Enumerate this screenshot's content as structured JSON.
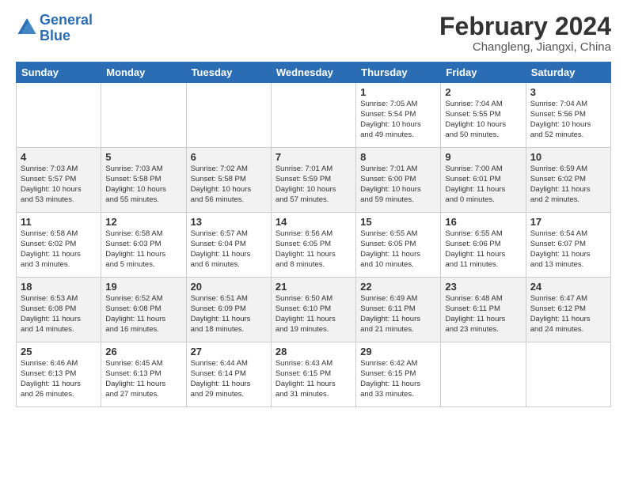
{
  "logo": {
    "line1": "General",
    "line2": "Blue"
  },
  "title": "February 2024",
  "subtitle": "Changleng, Jiangxi, China",
  "days_header": [
    "Sunday",
    "Monday",
    "Tuesday",
    "Wednesday",
    "Thursday",
    "Friday",
    "Saturday"
  ],
  "weeks": [
    [
      {
        "day": "",
        "info": ""
      },
      {
        "day": "",
        "info": ""
      },
      {
        "day": "",
        "info": ""
      },
      {
        "day": "",
        "info": ""
      },
      {
        "day": "1",
        "info": "Sunrise: 7:05 AM\nSunset: 5:54 PM\nDaylight: 10 hours\nand 49 minutes."
      },
      {
        "day": "2",
        "info": "Sunrise: 7:04 AM\nSunset: 5:55 PM\nDaylight: 10 hours\nand 50 minutes."
      },
      {
        "day": "3",
        "info": "Sunrise: 7:04 AM\nSunset: 5:56 PM\nDaylight: 10 hours\nand 52 minutes."
      }
    ],
    [
      {
        "day": "4",
        "info": "Sunrise: 7:03 AM\nSunset: 5:57 PM\nDaylight: 10 hours\nand 53 minutes."
      },
      {
        "day": "5",
        "info": "Sunrise: 7:03 AM\nSunset: 5:58 PM\nDaylight: 10 hours\nand 55 minutes."
      },
      {
        "day": "6",
        "info": "Sunrise: 7:02 AM\nSunset: 5:58 PM\nDaylight: 10 hours\nand 56 minutes."
      },
      {
        "day": "7",
        "info": "Sunrise: 7:01 AM\nSunset: 5:59 PM\nDaylight: 10 hours\nand 57 minutes."
      },
      {
        "day": "8",
        "info": "Sunrise: 7:01 AM\nSunset: 6:00 PM\nDaylight: 10 hours\nand 59 minutes."
      },
      {
        "day": "9",
        "info": "Sunrise: 7:00 AM\nSunset: 6:01 PM\nDaylight: 11 hours\nand 0 minutes."
      },
      {
        "day": "10",
        "info": "Sunrise: 6:59 AM\nSunset: 6:02 PM\nDaylight: 11 hours\nand 2 minutes."
      }
    ],
    [
      {
        "day": "11",
        "info": "Sunrise: 6:58 AM\nSunset: 6:02 PM\nDaylight: 11 hours\nand 3 minutes."
      },
      {
        "day": "12",
        "info": "Sunrise: 6:58 AM\nSunset: 6:03 PM\nDaylight: 11 hours\nand 5 minutes."
      },
      {
        "day": "13",
        "info": "Sunrise: 6:57 AM\nSunset: 6:04 PM\nDaylight: 11 hours\nand 6 minutes."
      },
      {
        "day": "14",
        "info": "Sunrise: 6:56 AM\nSunset: 6:05 PM\nDaylight: 11 hours\nand 8 minutes."
      },
      {
        "day": "15",
        "info": "Sunrise: 6:55 AM\nSunset: 6:05 PM\nDaylight: 11 hours\nand 10 minutes."
      },
      {
        "day": "16",
        "info": "Sunrise: 6:55 AM\nSunset: 6:06 PM\nDaylight: 11 hours\nand 11 minutes."
      },
      {
        "day": "17",
        "info": "Sunrise: 6:54 AM\nSunset: 6:07 PM\nDaylight: 11 hours\nand 13 minutes."
      }
    ],
    [
      {
        "day": "18",
        "info": "Sunrise: 6:53 AM\nSunset: 6:08 PM\nDaylight: 11 hours\nand 14 minutes."
      },
      {
        "day": "19",
        "info": "Sunrise: 6:52 AM\nSunset: 6:08 PM\nDaylight: 11 hours\nand 16 minutes."
      },
      {
        "day": "20",
        "info": "Sunrise: 6:51 AM\nSunset: 6:09 PM\nDaylight: 11 hours\nand 18 minutes."
      },
      {
        "day": "21",
        "info": "Sunrise: 6:50 AM\nSunset: 6:10 PM\nDaylight: 11 hours\nand 19 minutes."
      },
      {
        "day": "22",
        "info": "Sunrise: 6:49 AM\nSunset: 6:11 PM\nDaylight: 11 hours\nand 21 minutes."
      },
      {
        "day": "23",
        "info": "Sunrise: 6:48 AM\nSunset: 6:11 PM\nDaylight: 11 hours\nand 23 minutes."
      },
      {
        "day": "24",
        "info": "Sunrise: 6:47 AM\nSunset: 6:12 PM\nDaylight: 11 hours\nand 24 minutes."
      }
    ],
    [
      {
        "day": "25",
        "info": "Sunrise: 6:46 AM\nSunset: 6:13 PM\nDaylight: 11 hours\nand 26 minutes."
      },
      {
        "day": "26",
        "info": "Sunrise: 6:45 AM\nSunset: 6:13 PM\nDaylight: 11 hours\nand 27 minutes."
      },
      {
        "day": "27",
        "info": "Sunrise: 6:44 AM\nSunset: 6:14 PM\nDaylight: 11 hours\nand 29 minutes."
      },
      {
        "day": "28",
        "info": "Sunrise: 6:43 AM\nSunset: 6:15 PM\nDaylight: 11 hours\nand 31 minutes."
      },
      {
        "day": "29",
        "info": "Sunrise: 6:42 AM\nSunset: 6:15 PM\nDaylight: 11 hours\nand 33 minutes."
      },
      {
        "day": "",
        "info": ""
      },
      {
        "day": "",
        "info": ""
      }
    ]
  ]
}
